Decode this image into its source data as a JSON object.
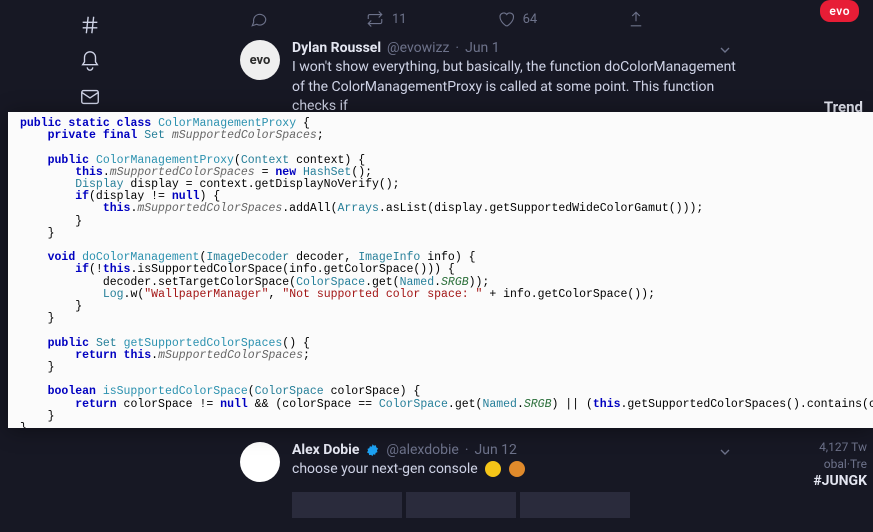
{
  "leftRail": {
    "icons": [
      "hash-icon",
      "bell-icon",
      "mail-icon"
    ]
  },
  "metrics": {
    "reply": "",
    "retweet": "11",
    "like": "64",
    "share": ""
  },
  "tweet1": {
    "avatarText": "evo",
    "name": "Dylan Roussel",
    "handle": "@evowizz",
    "sep": "·",
    "date": "Jun 1",
    "text": "I won't show everything, but basically, the function doColorManagement of the ColorManagementProxy is called at some point. This function checks if"
  },
  "tweet2": {
    "avatarText": " ",
    "name": "Alex Dobie",
    "handle": "@alexdobie",
    "sep": "·",
    "date": "Jun 12",
    "text": "choose your next-gen console"
  },
  "rightCol": {
    "badge": "evo",
    "trendLabel": "Trend",
    "trendCount": "4,127 Tw",
    "trendMeta": "obal·Tre",
    "hashtag": "#JUNGK"
  },
  "code": {
    "t01a": "public",
    "t01b": "static",
    "t01c": "class",
    "t01d": "ColorManagementProxy",
    "t01e": " {",
    "t02a": "private",
    "t02b": "final",
    "t02c": "Set",
    "t02d": "mSupportedColorSpaces",
    "t02e": ";",
    "t03a": "public",
    "t03b": "ColorManagementProxy",
    "t03c": "(",
    "t03d": "Context",
    "t03e": " context) {",
    "t04a": "this",
    "t04b": ".",
    "t04c": "mSupportedColorSpaces",
    "t04d": " = ",
    "t04e": "new",
    "t04f": "HashSet",
    "t04g": "();",
    "t05a": "Display",
    "t05b": " display = context.getDisplayNoVerify();",
    "t06a": "if",
    "t06b": "(display != ",
    "t06c": "null",
    "t06d": ") {",
    "t07a": "this",
    "t07b": ".",
    "t07c": "mSupportedColorSpaces",
    "t07d": ".addAll(",
    "t07e": "Arrays",
    "t07f": ".asList(display.getSupportedWideColorGamut()));",
    "t08a": "        }",
    "t09a": "    }",
    "t10a": "void",
    "t10b": "doColorManagement",
    "t10c": "(",
    "t10d": "ImageDecoder",
    "t10e": " decoder, ",
    "t10f": "ImageInfo",
    "t10g": " info) {",
    "t11a": "if",
    "t11b": "(!",
    "t11c": "this",
    "t11d": ".isSupportedColorSpace(info.getColorSpace())) {",
    "t12a": "decoder.setTargetColorSpace(",
    "t12b": "ColorSpace",
    "t12c": ".get(",
    "t12d": "Named",
    "t12e": ".",
    "t12f": "SRGB",
    "t12g": "));",
    "t13a": "Log",
    "t13b": ".w(",
    "t13c": "\"WallpaperManager\"",
    "t13d": ", ",
    "t13e": "\"Not supported color space: \"",
    "t13f": " + info.getColorSpace());",
    "t14a": "        }",
    "t15a": "    }",
    "t16a": "public",
    "t16b": "Set",
    "t16c": "getSupportedColorSpaces",
    "t16d": "() {",
    "t17a": "return",
    "t17b": "this",
    "t17c": ".",
    "t17d": "mSupportedColorSpaces",
    "t17e": ";",
    "t18a": "    }",
    "t19a": "boolean",
    "t19b": "isSupportedColorSpace",
    "t19c": "(",
    "t19d": "ColorSpace",
    "t19e": " colorSpace) {",
    "t20a": "return",
    "t20b": " colorSpace != ",
    "t20c": "null",
    "t20d": " && (colorSpace == ",
    "t20e": "ColorSpace",
    "t20f": ".get(",
    "t20g": "Named",
    "t20h": ".",
    "t20i": "SRGB",
    "t20j": ") || (",
    "t20k": "this",
    "t20l": ".getSupportedColorSpaces().contains(colorSpace)));",
    "t21a": "    }",
    "t22a": "}"
  }
}
